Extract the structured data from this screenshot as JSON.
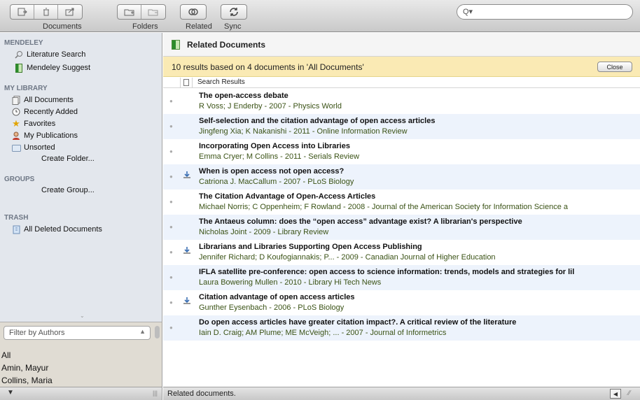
{
  "toolbar": {
    "documents_label": "Documents",
    "folders_label": "Folders",
    "related_label": "Related",
    "sync_label": "Sync",
    "search_placeholder": ""
  },
  "sidebar": {
    "mendeley_header": "MENDELEY",
    "mendeley_items": [
      {
        "label": "Literature Search",
        "icon": "magnifier-icon"
      },
      {
        "label": "Mendeley Suggest",
        "icon": "mendeley-book-icon"
      }
    ],
    "library_header": "MY LIBRARY",
    "library_items": [
      {
        "label": "All Documents",
        "icon": "documents-icon"
      },
      {
        "label": "Recently Added",
        "icon": "clock-icon"
      },
      {
        "label": "Favorites",
        "icon": "star-icon"
      },
      {
        "label": "My Publications",
        "icon": "person-icon"
      },
      {
        "label": "Unsorted",
        "icon": "folder-icon"
      }
    ],
    "create_folder": "Create Folder...",
    "groups_header": "GROUPS",
    "create_group": "Create Group...",
    "trash_header": "TRASH",
    "trash_item": "All Deleted Documents"
  },
  "filter": {
    "selected": "Filter by Authors",
    "authors": [
      "All",
      "Amin, Mayur",
      "Collins, Maria"
    ]
  },
  "main": {
    "header_title": "Related Documents",
    "notice": "10 results based on 4 documents in 'All Documents'",
    "close_label": "Close",
    "column_label": "Search Results",
    "results": [
      {
        "title": "The open-access debate",
        "meta": "R Voss; J Enderby - 2007 - Physics World",
        "download": false
      },
      {
        "title": "Self-selection and the citation advantage of open access articles",
        "meta": "Jingfeng Xia; K Nakanishi - 2011 - Online Information Review",
        "download": false
      },
      {
        "title": "Incorporating Open Access into Libraries",
        "meta": "Emma Cryer; M Collins - 2011 - Serials Review",
        "download": false
      },
      {
        "title": "When is open access not open access?",
        "meta": "Catriona J. MacCallum - 2007 - PLoS Biology",
        "download": true
      },
      {
        "title": "The Citation Advantage of Open-Access Articles",
        "meta": "Michael Norris; C Oppenheim; F Rowland - 2008 - Journal of the American Society for Information Science a",
        "download": false
      },
      {
        "title": "The Antaeus column: does the “open access” advantage exist? A librarian's perspective",
        "meta": "Nicholas Joint - 2009 - Library Review",
        "download": false
      },
      {
        "title": "Librarians and Libraries Supporting Open Access Publishing",
        "meta": "Jennifer Richard; D Koufogiannakis; P... - 2009 - Canadian Journal of Higher Education",
        "download": true
      },
      {
        "title": "IFLA satellite pre-conference: open access to science information: trends, models and strategies for lil",
        "meta": "Laura Bowering Mullen - 2010 - Library Hi Tech News",
        "download": false
      },
      {
        "title": "Citation advantage of open access articles",
        "meta": "Gunther Eysenbach - 2006 - PLoS Biology",
        "download": true
      },
      {
        "title": "Do open access articles have greater citation impact?. A critical review of the literature",
        "meta": "Iain D. Craig; AM Plume; ME McVeigh; ... - 2007 - Journal of Informetrics",
        "download": false
      }
    ]
  },
  "status": {
    "text": "Related documents."
  }
}
